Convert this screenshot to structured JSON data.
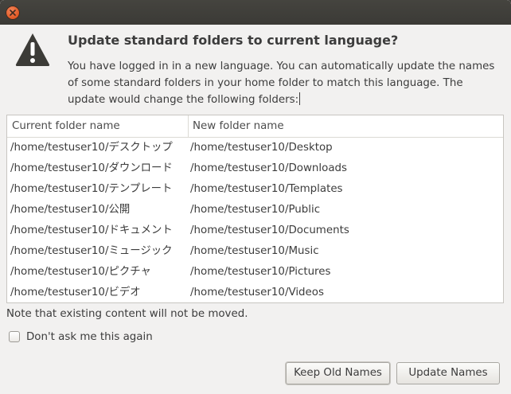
{
  "window": {
    "close_icon": "close-icon",
    "accent_close": "#e05a26"
  },
  "dialog": {
    "icon": "warning-icon",
    "heading": "Update standard folders to current language?",
    "description": "You have logged in in a new language. You can automatically update the names of some standard folders in your home folder to match this language. The update would change the following folders:"
  },
  "table": {
    "columns": [
      "Current folder name",
      "New folder name"
    ],
    "rows": [
      [
        "/home/testuser10/デスクトップ",
        "/home/testuser10/Desktop"
      ],
      [
        "/home/testuser10/ダウンロード",
        "/home/testuser10/Downloads"
      ],
      [
        "/home/testuser10/テンプレート",
        "/home/testuser10/Templates"
      ],
      [
        "/home/testuser10/公開",
        "/home/testuser10/Public"
      ],
      [
        "/home/testuser10/ドキュメント",
        "/home/testuser10/Documents"
      ],
      [
        "/home/testuser10/ミュージック",
        "/home/testuser10/Music"
      ],
      [
        "/home/testuser10/ピクチャ",
        "/home/testuser10/Pictures"
      ],
      [
        "/home/testuser10/ビデオ",
        "/home/testuser10/Videos"
      ]
    ]
  },
  "note": "Note that existing content will not be moved.",
  "checkbox": {
    "label": "Don't ask me this again",
    "checked": false
  },
  "buttons": {
    "keep_old": "Keep Old Names",
    "update": "Update Names"
  }
}
